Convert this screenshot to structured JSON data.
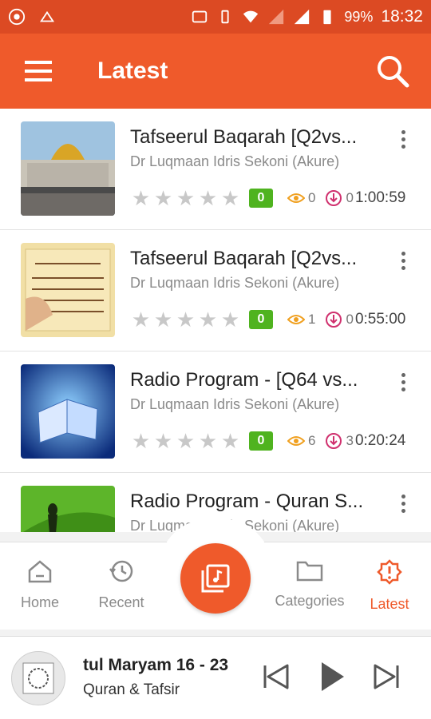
{
  "status_bar": {
    "battery": "99%",
    "time": "18:32"
  },
  "appbar": {
    "title": "Latest"
  },
  "items": [
    {
      "title": "Tafseerul Baqarah [Q2vs...",
      "speaker": "Dr Luqmaan Idris Sekoni (Akure)",
      "rating": 0,
      "badge": "0",
      "views": "0",
      "downloads": "0",
      "duration": "1:00:59"
    },
    {
      "title": "Tafseerul Baqarah [Q2vs...",
      "speaker": "Dr Luqmaan Idris Sekoni (Akure)",
      "rating": 0,
      "badge": "0",
      "views": "1",
      "downloads": "0",
      "duration": "0:55:00"
    },
    {
      "title": "Radio Program - [Q64 vs...",
      "speaker": "Dr Luqmaan Idris Sekoni (Akure)",
      "rating": 0,
      "badge": "0",
      "views": "6",
      "downloads": "3",
      "duration": "0:20:24"
    },
    {
      "title": "Radio Program - Quran S...",
      "speaker": "Dr Luqmaan Idris Sekoni (Akure)"
    }
  ],
  "bottom_nav": {
    "home": "Home",
    "recent": "Recent",
    "categories": "Categories",
    "latest": "Latest"
  },
  "player": {
    "title": "tul Maryam 16 - 23",
    "subtitle": "Quran & Tafsir"
  },
  "colors": {
    "primary": "#ef5a2b",
    "status_bar": "#dc4a23",
    "badge": "#4fb31f",
    "views_icon": "#f0a020",
    "download_icon": "#d0306e"
  }
}
